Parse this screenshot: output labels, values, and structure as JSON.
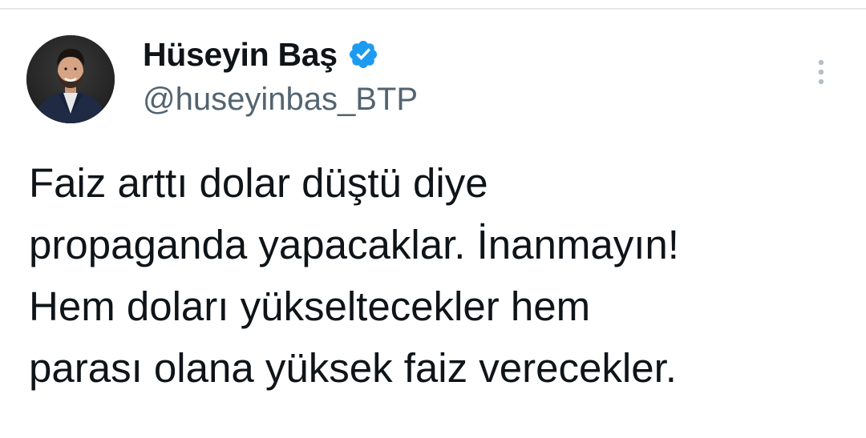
{
  "author": {
    "display_name": "Hüseyin Baş",
    "handle": "@huseyinbas_BTP",
    "verified": true,
    "avatar_icon": "profile-photo",
    "badge_icon": "verified-checkmark-icon",
    "badge_color": "#1d9bf0"
  },
  "menu": {
    "icon": "more-options-icon"
  },
  "tweet": {
    "lines": [
      "Faiz arttı dolar düştü diye",
      "propaganda yapacaklar. İnanmayın!",
      "Hem doları yükseltecekler hem",
      "parası olana yüksek faiz verecekler."
    ]
  },
  "colors": {
    "text_primary": "#0f1419",
    "text_secondary": "#536471",
    "background": "#ffffff"
  }
}
